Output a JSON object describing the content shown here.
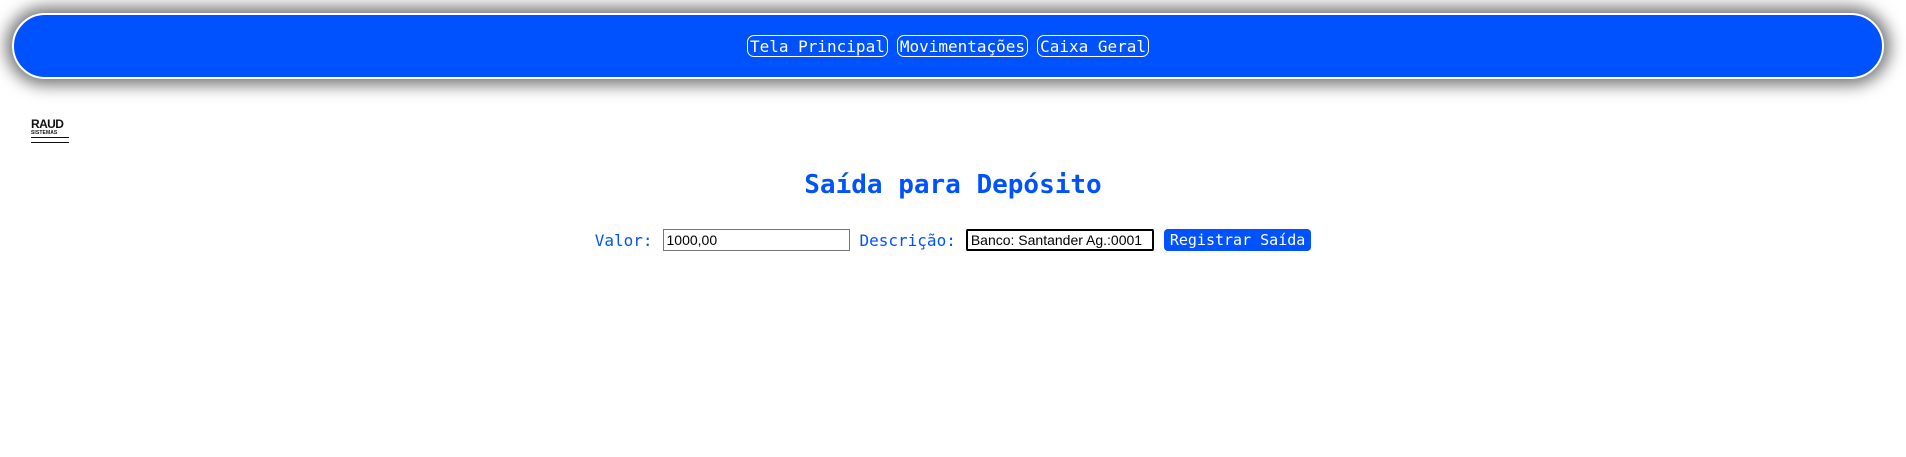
{
  "nav": {
    "items": [
      {
        "label": "Tela Principal"
      },
      {
        "label": "Movimentações"
      },
      {
        "label": "Caixa Geral"
      }
    ]
  },
  "logo": {
    "main": "RAUD",
    "sub": "SISTEMAS"
  },
  "page": {
    "title": "Saída para Depósito"
  },
  "form": {
    "valor_label": "Valor:",
    "valor_value": "1000,00",
    "descricao_label": "Descrição:",
    "descricao_value": "Banco: Santander Ag.:0001",
    "submit_label": "Registrar Saída"
  },
  "colors": {
    "accent": "#0052ff",
    "background": "#ffffff"
  }
}
